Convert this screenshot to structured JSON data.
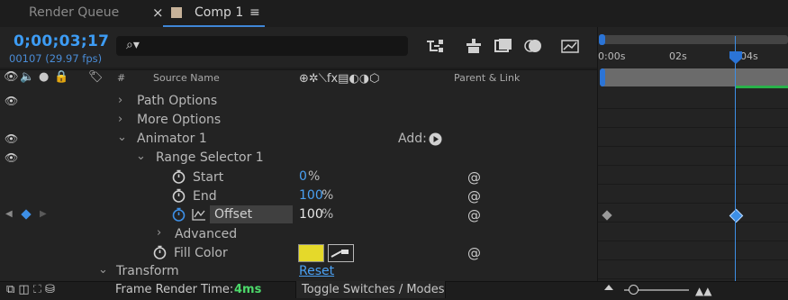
{
  "tabs": {
    "render_queue": "Render Queue",
    "close_glyph": "×",
    "comp": "Comp 1",
    "menu_glyph": "≡",
    "comp_color": "#c7b299"
  },
  "header": {
    "timecode": "0;00;03;17",
    "frames": "00107 (29.97 fps)",
    "search_placeholder": ""
  },
  "columns": {
    "hash": "#",
    "source_name": "Source Name",
    "switches": "⊕✲⟍fx▤◐◑⬡",
    "parent_link": "Parent & Link"
  },
  "rows": [
    {
      "label": "Path Options",
      "twirl": "›"
    },
    {
      "label": "More Options",
      "twirl": "›"
    },
    {
      "label": "Animator 1",
      "twirl": "⌄",
      "add_label": "Add:"
    },
    {
      "label": "Range Selector 1",
      "twirl": "⌄"
    },
    {
      "label": "Start",
      "value": "0",
      "unit": "%"
    },
    {
      "label": "End",
      "value": "100",
      "unit": "%"
    },
    {
      "label": "Offset",
      "value": "100",
      "unit": "%"
    },
    {
      "label": "Advanced",
      "twirl": "›"
    },
    {
      "label": "Fill Color",
      "swatch": "#e5d92a"
    },
    {
      "label": "Transform",
      "twirl": "⌄",
      "reset": "Reset"
    }
  ],
  "timeline": {
    "ticks": [
      "0:00s",
      "02s",
      "04s"
    ],
    "cti_time": "04s"
  },
  "footer": {
    "frame_render_label": "Frame Render Time:",
    "frame_render_value": "4ms",
    "toggle_label": "Toggle Switches / Modes"
  },
  "colors": {
    "accent": "#2b74d6",
    "timecode": "#3d9cf4",
    "value": "#4aa0f2",
    "render_time": "#4cd96a"
  }
}
